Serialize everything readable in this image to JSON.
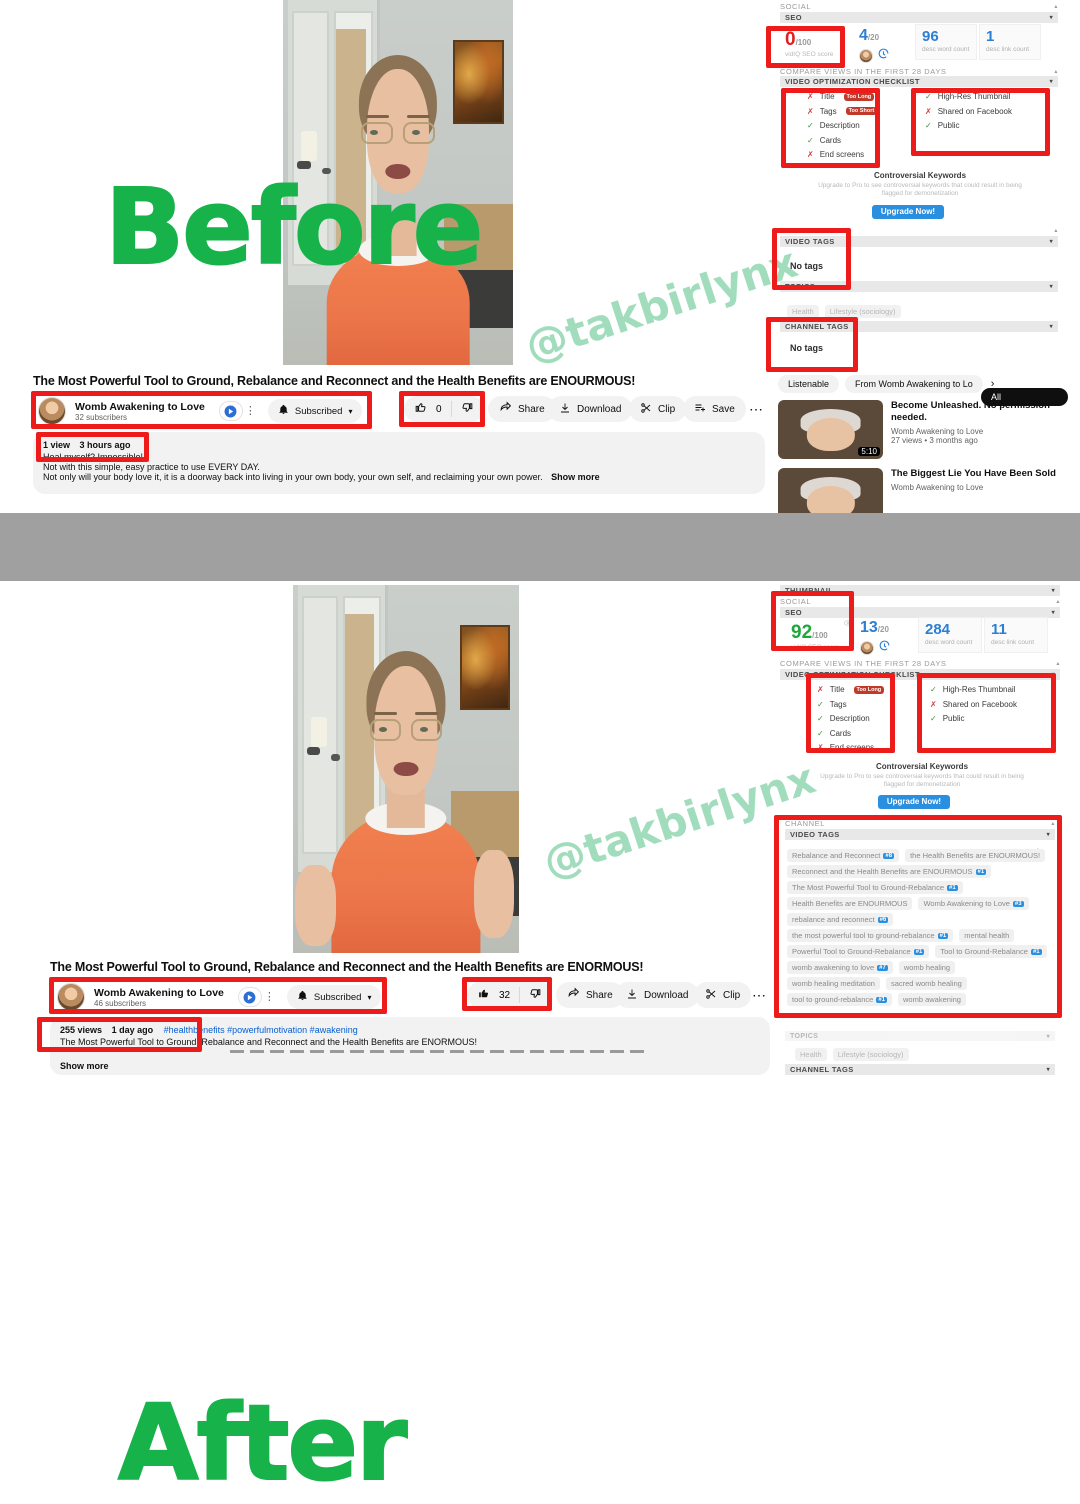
{
  "overlay": {
    "before_label": "Before",
    "after_label": "After",
    "watermark": "@takbirlynx",
    "watermark_color": "#9ddcb9",
    "label_color": "#17b34a"
  },
  "before": {
    "video": {
      "title": "The Most Powerful Tool to Ground, Rebalance and Reconnect and the Health Benefits are ENOURMOUS!",
      "channel_name": "Womb Awakening to Love",
      "subscribers": "32 subscribers",
      "join_icon": "join-badge-icon",
      "more_icon": "kebab-menu-icon",
      "bell_icon": "bell-icon",
      "subscribed_label": "Subscribed",
      "chevron_icon": "chevron-down-icon",
      "like_icon": "thumbs-up-icon",
      "like_count": "0",
      "dislike_icon": "thumbs-down-icon",
      "share_icon": "share-icon",
      "share_label": "Share",
      "download_icon": "download-icon",
      "download_label": "Download",
      "clip_icon": "scissors-icon",
      "clip_label": "Clip",
      "save_icon": "save-playlist-icon",
      "save_label": "Save",
      "overflow_icon": "ellipsis-icon",
      "views": "1 view",
      "published": "3 hours ago",
      "desc_line1": "Heal myself? Impossible!",
      "desc_line2": "Not with this simple, easy practice to use EVERY DAY.",
      "desc_line3": "Not only will your body love it, it is a doorway back into living in your own body, your own self, and reclaiming your own power.",
      "show_more": "Show more"
    },
    "vidiq": {
      "group_social": "SOCIAL",
      "section_seo": "SEO",
      "seo_score": "0",
      "seo_score_den": "/100",
      "seo_score_label": "vidIQ SEO score",
      "tags_score": "4",
      "tags_score_den": "/20",
      "desc_word_count": "96",
      "desc_word_count_label": "desc word count",
      "desc_link_count": "1",
      "desc_link_count_label": "desc link count",
      "compare_views": "COMPARE VIEWS IN THE FIRST 28 DAYS",
      "checklist_header": "VIDEO OPTIMIZATION CHECKLIST",
      "checklist_left": [
        {
          "state": "x",
          "label": "Title",
          "badge": "Too Long"
        },
        {
          "state": "x",
          "label": "Tags",
          "badge": "Too Short"
        },
        {
          "state": "check",
          "label": "Description",
          "badge": ""
        },
        {
          "state": "check",
          "label": "Cards",
          "badge": ""
        },
        {
          "state": "x",
          "label": "End screens",
          "badge": ""
        }
      ],
      "checklist_right": [
        {
          "state": "check",
          "label": "High-Res Thumbnail"
        },
        {
          "state": "x",
          "label": "Shared on Facebook"
        },
        {
          "state": "check",
          "label": "Public"
        }
      ],
      "controversial_title": "Controversial Keywords",
      "controversial_sub": "Upgrade to Pro to see controversial keywords that could result in being flagged for demonetization",
      "upgrade_label": "Upgrade Now!",
      "group_channel": "CHANNEL",
      "video_tags_header": "VIDEO TAGS",
      "video_tags_empty": "No tags",
      "topics_header": "TOPICS",
      "topics": [
        "Health",
        "Lifestyle (sociology)"
      ],
      "channel_tags_header": "CHANNEL TAGS",
      "channel_tags_empty": "No tags"
    },
    "suggestions": {
      "chips": [
        "All",
        "Listenable",
        "From Womb Awakening to Lo"
      ],
      "chip_next_icon": "chevron-right-icon",
      "items": [
        {
          "title": "Become Unleashed. No permission needed.",
          "channel": "Womb Awakening to Love",
          "meta": "27 views  •  3 months ago",
          "duration": "5:10"
        },
        {
          "title": "The Biggest Lie You Have Been Sold",
          "channel": "Womb Awakening to Love",
          "meta": "",
          "duration": ""
        }
      ]
    }
  },
  "after": {
    "video": {
      "title": "The Most Powerful Tool to Ground, Rebalance and Reconnect and the Health Benefits are ENORMOUS!",
      "channel_name": "Womb Awakening to Love",
      "subscribers": "46 subscribers",
      "join_icon": "join-badge-icon",
      "more_icon": "kebab-menu-icon",
      "bell_icon": "bell-icon",
      "subscribed_label": "Subscribed",
      "chevron_icon": "chevron-down-icon",
      "like_icon": "thumbs-up-icon",
      "like_count": "32",
      "dislike_icon": "thumbs-down-icon",
      "share_icon": "share-icon",
      "share_label": "Share",
      "download_icon": "download-icon",
      "download_label": "Download",
      "clip_icon": "scissors-icon",
      "clip_label": "Clip",
      "overflow_icon": "ellipsis-icon",
      "views": "255 views",
      "published": "1 day ago",
      "hashtags": "#healthbenefits #powerfulmotivation #awakening",
      "desc_line1": "The Most Powerful Tool to Ground, Rebalance and Reconnect and the Health Benefits are ENORMOUS!",
      "show_more": "Show more"
    },
    "vidiq": {
      "group_thumbnail": "THUMBNAIL",
      "group_social": "SOCIAL",
      "section_seo": "SEO",
      "eye_icon": "eye-icon",
      "seo_score": "92",
      "seo_score_den": "/100",
      "seo_score_label": "vidIQ SEO score",
      "tags_score": "13",
      "tags_score_den": "/20",
      "desc_word_count": "284",
      "desc_word_count_label": "desc word count",
      "desc_link_count": "11",
      "desc_link_count_label": "desc link count",
      "compare_views": "COMPARE VIEWS IN THE FIRST 28 DAYS",
      "checklist_header": "VIDEO OPTIMIZATION CHECKLIST",
      "checklist_left": [
        {
          "state": "x",
          "label": "Title",
          "badge": "Too Long"
        },
        {
          "state": "check",
          "label": "Tags",
          "badge": ""
        },
        {
          "state": "check",
          "label": "Description",
          "badge": ""
        },
        {
          "state": "check",
          "label": "Cards",
          "badge": ""
        },
        {
          "state": "x",
          "label": "End screens",
          "badge": ""
        }
      ],
      "checklist_right": [
        {
          "state": "check",
          "label": "High-Res Thumbnail"
        },
        {
          "state": "x",
          "label": "Shared on Facebook"
        },
        {
          "state": "check",
          "label": "Public"
        }
      ],
      "controversial_title": "Controversial Keywords",
      "controversial_sub": "Upgrade to Pro to see controversial keywords that could result in being flagged for demonetization",
      "upgrade_label": "Upgrade Now!",
      "group_channel": "CHANNEL",
      "video_tags_header": "VIDEO TAGS",
      "download_icon": "download-icon",
      "copy_icon": "paperclip-icon",
      "video_tags": [
        {
          "label": "Rebalance and Reconnect",
          "rank": "#8"
        },
        {
          "label": "the Health Benefits are ENOURMOUS!",
          "rank": ""
        },
        {
          "label": "Reconnect and the Health Benefits are ENOURMOUS",
          "rank": "#1"
        },
        {
          "label": "The Most Powerful Tool to Ground-Rebalance",
          "rank": "#1"
        },
        {
          "label": "Health Benefits are ENOURMOUS",
          "rank": ""
        },
        {
          "label": "Womb Awakening to Love",
          "rank": "#3"
        },
        {
          "label": "rebalance and reconnect",
          "rank": "#6"
        },
        {
          "label": "the most powerful tool to ground-rebalance",
          "rank": "#1"
        },
        {
          "label": "mental health",
          "rank": ""
        },
        {
          "label": "Powerful Tool to Ground-Rebalance",
          "rank": "#1"
        },
        {
          "label": "Tool to Ground-Rebalance",
          "rank": "#1"
        },
        {
          "label": "womb awakening to love",
          "rank": "#7"
        },
        {
          "label": "womb healing",
          "rank": ""
        },
        {
          "label": "womb healing meditation",
          "rank": ""
        },
        {
          "label": "sacred womb healing",
          "rank": ""
        },
        {
          "label": "tool to ground-rebalance",
          "rank": "#1"
        },
        {
          "label": "womb awakening",
          "rank": ""
        }
      ],
      "topics_header": "TOPICS",
      "topics": [
        "Health",
        "Lifestyle (sociology)"
      ],
      "channel_tags_header": "CHANNEL TAGS"
    }
  }
}
